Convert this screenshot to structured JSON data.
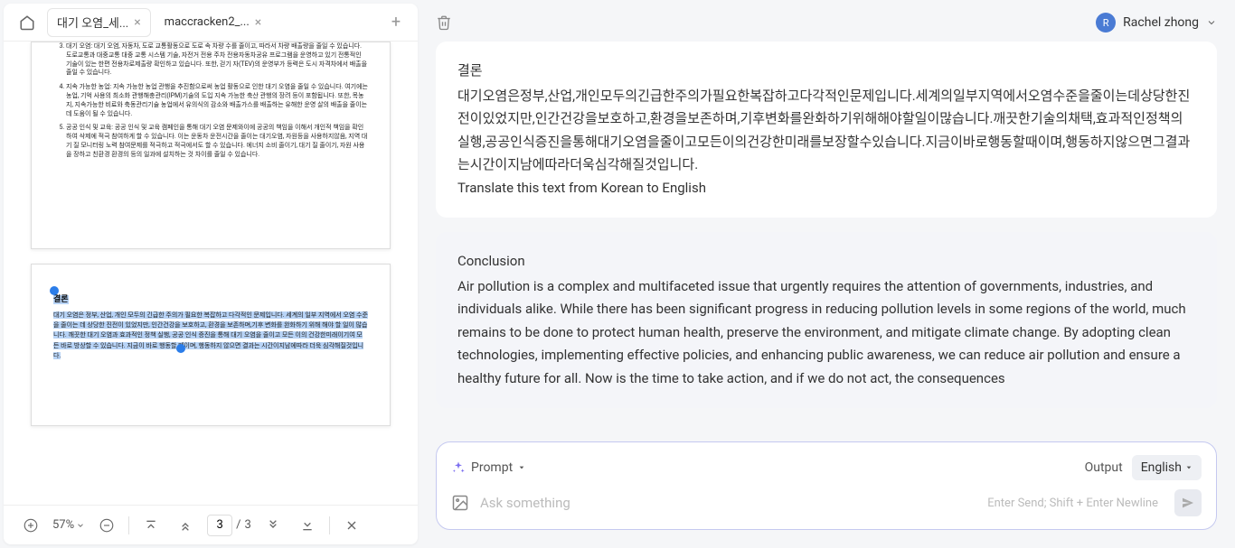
{
  "tabs": [
    {
      "label": "대기 오염_세...",
      "active": true
    },
    {
      "label": "maccracken2_...",
      "active": false
    }
  ],
  "zoom": "57%",
  "page_current": "3",
  "page_total": "3",
  "thumb1_items": [
    "대기 오염: 대기 오염, 자동차, 도로 교통활동으로 도로 속 차량 수를 줄이고, 따라서 차량 배출량을 줄일 수 있습니다. 도로교통과 대중교통 대중 교통 시스템 기술, 자전거 전용 주차 전용자동차공유 프로그램을 운영하고 있기 전통적인 기술이 있는 한편 전용차로제출량 확인하고 있습니다. 또한, 걷기 자(TEV)의 운영부가 등력은 도시 자격차에서 배출을 줄일 수 있습니다.",
    "지속 가능한 농업: 지속 가능한 농업 관행을 추진함으로써 농업 활동으로 인한 대기 오염을 줄일 수 있습니다. 여기에는 농업, 기억 사용의 최소화 관행해충관리(IPM)기술의 도입 지속 가능한 축산 관행의 장려 등이 포함됩니다. 또한, 목농지, 지속가능한 비료와 축동관리기술 농업에서 유의식의 감소와 배출가스를 배출하는 유해한 운영 살의 배출을 줄이는 데 도움이 될 수 있습니다.",
    "공공 인식 및 교육: 공공 인식 및 교육 캠페인을 통해 대기 오염 문제와이에 공공의 책임을 이해서 개인적 책임을 확인하여 삭제에 적극 참여하게 할 수 있습니다. 이는 운동차 운전시간을 줄이는 대기오염, 자원등을 사용하지않음, 지역 대기 질 모니터링 노력 참여문제를 적극하고 적극에서도 할 수 있습니다. 에너지 소비 줄이기, 대기 질 줄이기, 자원 사용을 장하고 친환경 환경의 등의 일과에 설치하는 것 차이를 줄일 수 있습니다."
  ],
  "thumb2_heading": "결론",
  "thumb2_body": "대기 오염은 정부, 산업, 개인 모두의 긴급한 주의가 필요한 복잡하고 다각적인 문제입니다. 세계의 일부 지역에서 오염 수준을 줄이는 데 상당한 진전이 있었지만, 인간건강을 보호하고, 환경을 보존하며,기후 변화를 완화하기 위해 해야 할 일이 많습니다. 깨끗한 대기 오염과 효과적인 정책 실행, 공공 인식 증진을 통해 대기 오염을 줄이고 모든 이의 건강한미래이기여 모든 바로 방상할 수 있습니다. 지금이 바로 행동할 때이며, 행동하지 않으면 결과는 시간이지남에따라 더욱 심각해질것입니다.",
  "user": {
    "initial": "R",
    "name": "Rachel zhong"
  },
  "user_msg": {
    "heading": "결론",
    "body": "대기오염은정부,산업,개인모두의긴급한주의가필요한복잡하고다각적인문제입니다.세계의일부지역에서오염수준을줄이는데상당한진전이있었지만,인간건강을보호하고,환경을보존하며,기후변화를완화하기위해해야할일이많습니다.깨끗한기술의채택,효과적인정책의실행,공공인식증진을통해대기오염을줄이고모든이의건강한미래를보장할수있습니다.지금이바로행동할때이며,행동하지않으면그결과는시간이지남에따라더욱심각해질것입니다.",
    "instruction": "Translate this text from Korean to English"
  },
  "ai_msg": {
    "heading": "Conclusion",
    "body": "Air pollution is a complex and multifaceted issue that urgently requires the attention of governments, industries, and individuals alike. While there has been significant progress in reducing pollution levels in some regions of the world, much remains to be done to protect human health, preserve the environment, and mitigate climate change. By adopting clean technologies, implementing effective policies, and enhancing public awareness, we can reduce air pollution and ensure a healthy future for all. Now is the time to take action, and if we do not act, the consequences"
  },
  "prompt_label": "Prompt",
  "output_label": "Output",
  "output_lang": "English",
  "ask_placeholder": "Ask something",
  "input_hint": "Enter Send; Shift + Enter Newline"
}
